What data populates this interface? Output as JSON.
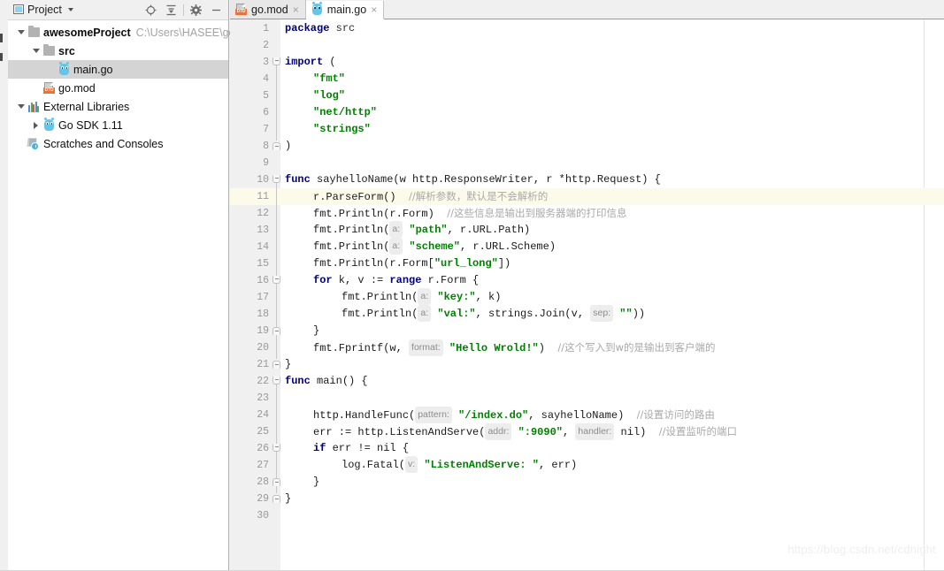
{
  "panel": {
    "title": "Project",
    "project_icon": "project-window-icon",
    "caret": "chevron-down-icon",
    "tools": [
      {
        "name": "locate-in-tree-icon",
        "tooltip": "Select Opened File"
      },
      {
        "name": "collapse-all-icon",
        "tooltip": "Collapse All"
      },
      {
        "name": "gear-icon",
        "tooltip": "Settings"
      },
      {
        "name": "minimize-icon",
        "tooltip": "Hide"
      }
    ]
  },
  "tree": [
    {
      "label": "awesomeProject",
      "path": "C:\\Users\\HASEE\\go",
      "icon": "folder-icon",
      "arrow": "chevron-down-icon",
      "indent": 0,
      "bold": true,
      "selected": false
    },
    {
      "label": "src",
      "path": "",
      "icon": "folder-icon",
      "arrow": "chevron-down-icon",
      "indent": 1,
      "bold": true,
      "selected": false
    },
    {
      "label": "main.go",
      "path": "",
      "icon": "go-file-icon",
      "arrow": "",
      "indent": 2,
      "bold": false,
      "selected": true
    },
    {
      "label": "go.mod",
      "path": "",
      "icon": "dtd-file-icon",
      "arrow": "",
      "indent": 1,
      "bold": false,
      "selected": false
    },
    {
      "label": "External Libraries",
      "path": "",
      "icon": "libraries-icon",
      "arrow": "chevron-down-icon",
      "indent": 0,
      "bold": false,
      "selected": false
    },
    {
      "label": "Go SDK 1.11",
      "path": "",
      "icon": "go-sdk-icon",
      "arrow": "chevron-right-icon",
      "indent": 1,
      "bold": false,
      "selected": false
    },
    {
      "label": "Scratches and Consoles",
      "path": "",
      "icon": "scratches-icon",
      "arrow": "",
      "indent": 0,
      "bold": false,
      "selected": false
    }
  ],
  "tabs": [
    {
      "label": "go.mod",
      "icon": "dtd-file-icon",
      "active": false,
      "close": "×"
    },
    {
      "label": "main.go",
      "icon": "go-file-icon",
      "active": true,
      "close": "×"
    }
  ],
  "editor": {
    "current_line": 11,
    "total_lines": 30,
    "watermark": "https://blog.csdn.net/cdnight",
    "colors": {
      "keyword": "#000080",
      "string": "#008000",
      "comment": "#a9a9a9",
      "hint_bg": "#ededed",
      "hint_fg": "#8c8c8c",
      "current_line_bg": "#fcfbe9",
      "gutter_bg": "#f0f0f0",
      "line_number": "#999999"
    },
    "lines": [
      {
        "n": 1,
        "indent": 0,
        "tokens": [
          {
            "t": "kw",
            "v": "package"
          },
          {
            "t": "pln",
            "v": " "
          },
          {
            "t": "pkgname",
            "v": "src"
          }
        ]
      },
      {
        "n": 2,
        "indent": 0,
        "tokens": []
      },
      {
        "n": 3,
        "indent": 0,
        "tokens": [
          {
            "t": "kw",
            "v": "import"
          },
          {
            "t": "pln",
            "v": " ("
          }
        ]
      },
      {
        "n": 4,
        "indent": 1,
        "tokens": [
          {
            "t": "str",
            "v": "\"fmt\""
          }
        ]
      },
      {
        "n": 5,
        "indent": 1,
        "tokens": [
          {
            "t": "str",
            "v": "\"log\""
          }
        ]
      },
      {
        "n": 6,
        "indent": 1,
        "tokens": [
          {
            "t": "str",
            "v": "\"net/http\""
          }
        ]
      },
      {
        "n": 7,
        "indent": 1,
        "tokens": [
          {
            "t": "str",
            "v": "\"strings\""
          }
        ]
      },
      {
        "n": 8,
        "indent": 0,
        "tokens": [
          {
            "t": "pln",
            "v": ")"
          }
        ]
      },
      {
        "n": 9,
        "indent": 0,
        "tokens": []
      },
      {
        "n": 10,
        "indent": 0,
        "tokens": [
          {
            "t": "kw",
            "v": "func"
          },
          {
            "t": "pln",
            "v": " sayhelloName(w http.ResponseWriter, r *http.Request) {"
          }
        ]
      },
      {
        "n": 11,
        "indent": 1,
        "tokens": [
          {
            "t": "pln",
            "v": "r.ParseForm()  "
          },
          {
            "t": "cmt",
            "v": "//解析参数，默认是不会解析的"
          }
        ]
      },
      {
        "n": 12,
        "indent": 1,
        "tokens": [
          {
            "t": "pln",
            "v": "fmt.Println(r.Form)  "
          },
          {
            "t": "cmt",
            "v": "//这些信息是输出到服务器端的打印信息"
          }
        ]
      },
      {
        "n": 13,
        "indent": 1,
        "tokens": [
          {
            "t": "pln",
            "v": "fmt.Println("
          },
          {
            "t": "hint",
            "v": "a:"
          },
          {
            "t": "pln",
            "v": " "
          },
          {
            "t": "str",
            "v": "\"path\""
          },
          {
            "t": "pln",
            "v": ", r.URL.Path)"
          }
        ]
      },
      {
        "n": 14,
        "indent": 1,
        "tokens": [
          {
            "t": "pln",
            "v": "fmt.Println("
          },
          {
            "t": "hint",
            "v": "a:"
          },
          {
            "t": "pln",
            "v": " "
          },
          {
            "t": "str",
            "v": "\"scheme\""
          },
          {
            "t": "pln",
            "v": ", r.URL.Scheme)"
          }
        ]
      },
      {
        "n": 15,
        "indent": 1,
        "tokens": [
          {
            "t": "pln",
            "v": "fmt.Println(r.Form["
          },
          {
            "t": "str",
            "v": "\"url_long\""
          },
          {
            "t": "pln",
            "v": "])"
          }
        ]
      },
      {
        "n": 16,
        "indent": 1,
        "tokens": [
          {
            "t": "kw",
            "v": "for"
          },
          {
            "t": "pln",
            "v": " k, v := "
          },
          {
            "t": "kw",
            "v": "range"
          },
          {
            "t": "pln",
            "v": " r.Form {"
          }
        ]
      },
      {
        "n": 17,
        "indent": 2,
        "tokens": [
          {
            "t": "pln",
            "v": "fmt.Println("
          },
          {
            "t": "hint",
            "v": "a:"
          },
          {
            "t": "pln",
            "v": " "
          },
          {
            "t": "str",
            "v": "\"key:\""
          },
          {
            "t": "pln",
            "v": ", k)"
          }
        ]
      },
      {
        "n": 18,
        "indent": 2,
        "tokens": [
          {
            "t": "pln",
            "v": "fmt.Println("
          },
          {
            "t": "hint",
            "v": "a:"
          },
          {
            "t": "pln",
            "v": " "
          },
          {
            "t": "str",
            "v": "\"val:\""
          },
          {
            "t": "pln",
            "v": ", strings.Join(v, "
          },
          {
            "t": "hint",
            "v": "sep:"
          },
          {
            "t": "pln",
            "v": " "
          },
          {
            "t": "str",
            "v": "\"\""
          },
          {
            "t": "pln",
            "v": "))"
          }
        ]
      },
      {
        "n": 19,
        "indent": 1,
        "tokens": [
          {
            "t": "pln",
            "v": "}"
          }
        ]
      },
      {
        "n": 20,
        "indent": 1,
        "tokens": [
          {
            "t": "pln",
            "v": "fmt.Fprintf(w, "
          },
          {
            "t": "hint",
            "v": "format:"
          },
          {
            "t": "pln",
            "v": " "
          },
          {
            "t": "str",
            "v": "\"Hello Wrold!\""
          },
          {
            "t": "pln",
            "v": ")  "
          },
          {
            "t": "cmt",
            "v": "//这个写入到w的是输出到客户端的"
          }
        ]
      },
      {
        "n": 21,
        "indent": 0,
        "tokens": [
          {
            "t": "pln",
            "v": "}"
          }
        ]
      },
      {
        "n": 22,
        "indent": 0,
        "tokens": [
          {
            "t": "kw",
            "v": "func"
          },
          {
            "t": "pln",
            "v": " main() {"
          }
        ]
      },
      {
        "n": 23,
        "indent": 0,
        "tokens": []
      },
      {
        "n": 24,
        "indent": 1,
        "tokens": [
          {
            "t": "pln",
            "v": "http.HandleFunc("
          },
          {
            "t": "hint",
            "v": "pattern:"
          },
          {
            "t": "pln",
            "v": " "
          },
          {
            "t": "str",
            "v": "\"/index.do\""
          },
          {
            "t": "pln",
            "v": ", sayhelloName)  "
          },
          {
            "t": "cmt",
            "v": "//设置访问的路由"
          }
        ]
      },
      {
        "n": 25,
        "indent": 1,
        "tokens": [
          {
            "t": "pln",
            "v": "err := http.ListenAndServe("
          },
          {
            "t": "hint",
            "v": "addr:"
          },
          {
            "t": "pln",
            "v": " "
          },
          {
            "t": "str",
            "v": "\":9090\""
          },
          {
            "t": "pln",
            "v": ", "
          },
          {
            "t": "hint",
            "v": "handler:"
          },
          {
            "t": "pln",
            "v": " nil)  "
          },
          {
            "t": "cmt",
            "v": "//设置监听的端口"
          }
        ]
      },
      {
        "n": 26,
        "indent": 1,
        "tokens": [
          {
            "t": "kw",
            "v": "if"
          },
          {
            "t": "pln",
            "v": " err != nil {"
          }
        ]
      },
      {
        "n": 27,
        "indent": 2,
        "tokens": [
          {
            "t": "pln",
            "v": "log.Fatal("
          },
          {
            "t": "hint",
            "v": "v:"
          },
          {
            "t": "pln",
            "v": " "
          },
          {
            "t": "str",
            "v": "\"ListenAndServe: \""
          },
          {
            "t": "pln",
            "v": ", err)"
          }
        ]
      },
      {
        "n": 28,
        "indent": 1,
        "tokens": [
          {
            "t": "pln",
            "v": "}"
          }
        ]
      },
      {
        "n": 29,
        "indent": 0,
        "tokens": [
          {
            "t": "pln",
            "v": "}"
          }
        ]
      },
      {
        "n": 30,
        "indent": 0,
        "tokens": []
      }
    ],
    "folds": [
      {
        "line": 3,
        "type": "start"
      },
      {
        "line": 8,
        "type": "end"
      },
      {
        "line": 10,
        "type": "start"
      },
      {
        "line": 16,
        "type": "start"
      },
      {
        "line": 19,
        "type": "end"
      },
      {
        "line": 21,
        "type": "end"
      },
      {
        "line": 22,
        "type": "start"
      },
      {
        "line": 26,
        "type": "start"
      },
      {
        "line": 28,
        "type": "end"
      },
      {
        "line": 29,
        "type": "end"
      }
    ],
    "fold_lines": [
      {
        "from": 3,
        "to": 8
      },
      {
        "from": 10,
        "to": 21
      },
      {
        "from": 16,
        "to": 19
      },
      {
        "from": 22,
        "to": 29
      },
      {
        "from": 26,
        "to": 28
      }
    ]
  }
}
